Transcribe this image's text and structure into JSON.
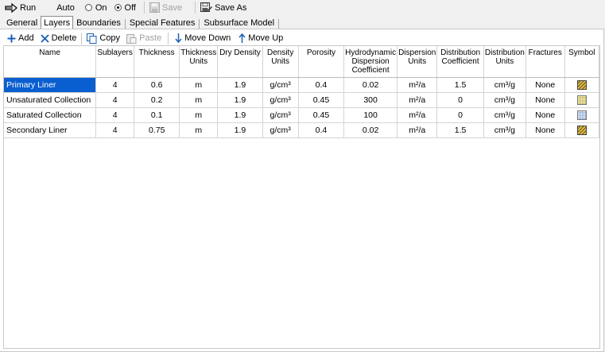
{
  "toolbar": {
    "run_label": "Run",
    "auto_label": "Auto",
    "on_label": "On",
    "off_label": "Off",
    "save_label": "Save",
    "save_as_label": "Save As"
  },
  "tabs": [
    {
      "label": "General",
      "active": false
    },
    {
      "label": "Layers",
      "active": true
    },
    {
      "label": "Boundaries",
      "active": false
    },
    {
      "label": "Special Features",
      "active": false
    },
    {
      "label": "Subsurface Model",
      "active": false
    }
  ],
  "layer_toolbar": {
    "add_label": "Add",
    "delete_label": "Delete",
    "copy_label": "Copy",
    "paste_label": "Paste",
    "move_down_label": "Move Down",
    "move_up_label": "Move Up"
  },
  "table": {
    "headers": {
      "name": "Name",
      "sublayers": "Sublayers",
      "thickness": "Thickness",
      "thickness_units": "Thickness Units",
      "dry_density": "Dry Density",
      "density_units": "Density Units",
      "porosity": "Porosity",
      "hydro": "Hydrodynamic Dispersion Coefficient",
      "dispersion_units": "Dispersion Units",
      "distribution": "Distribution Coefficient",
      "distribution_units": "Distribution Units",
      "fractures": "Fractures",
      "symbol": "Symbol"
    },
    "rows": [
      {
        "name": "Primary Liner",
        "sublayers": "4",
        "thickness": "0.6",
        "thickness_units": "m",
        "dry_density": "1.9",
        "density_units": "g/cm³",
        "porosity": "0.4",
        "hydro": "0.02",
        "dispersion_units": "m²/a",
        "distribution": "1.5",
        "distribution_units": "cm³/g",
        "fractures": "None",
        "symbol": "diagonal-hatch-icon"
      },
      {
        "name": "Unsaturated Collection",
        "sublayers": "4",
        "thickness": "0.2",
        "thickness_units": "m",
        "dry_density": "1.9",
        "density_units": "g/cm³",
        "porosity": "0.45",
        "hydro": "300",
        "dispersion_units": "m²/a",
        "distribution": "0",
        "distribution_units": "cm³/g",
        "fractures": "None",
        "symbol": "dotted-yellow-icon"
      },
      {
        "name": "Saturated Collection",
        "sublayers": "4",
        "thickness": "0.1",
        "thickness_units": "m",
        "dry_density": "1.9",
        "density_units": "g/cm³",
        "porosity": "0.45",
        "hydro": "100",
        "dispersion_units": "m²/a",
        "distribution": "0",
        "distribution_units": "cm³/g",
        "fractures": "None",
        "symbol": "dotted-blue-icon"
      },
      {
        "name": "Secondary Liner",
        "sublayers": "4",
        "thickness": "0.75",
        "thickness_units": "m",
        "dry_density": "1.9",
        "density_units": "g/cm³",
        "porosity": "0.4",
        "hydro": "0.02",
        "dispersion_units": "m²/a",
        "distribution": "1.5",
        "distribution_units": "cm³/g",
        "fractures": "None",
        "symbol": "diagonal-hatch-icon"
      }
    ]
  },
  "colors": {
    "selection": "#0a5fd0",
    "add_icon": "#1a5fb4",
    "delete_icon": "#1a5fb4"
  }
}
